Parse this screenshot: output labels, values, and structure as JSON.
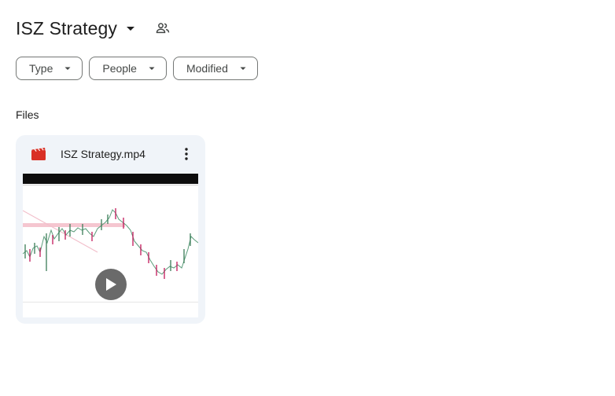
{
  "header": {
    "folder_title": "ISZ Strategy",
    "shared_icon": "shared-people-icon",
    "caret_icon": "arrow-drop-down-icon"
  },
  "filters": {
    "type_label": "Type",
    "people_label": "People",
    "modified_label": "Modified"
  },
  "files_section": {
    "label": "Files",
    "items": [
      {
        "name": "ISZ Strategy.mp4",
        "file_type_icon": "video-file-icon",
        "menu_icon": "more-vert-icon",
        "thumbnail_overlay_icon": "play-icon"
      }
    ]
  },
  "colors": {
    "card_background": "#f0f4f9",
    "video_icon": "#d93025",
    "chip_border": "#747775",
    "text": "#1f1f1f"
  }
}
